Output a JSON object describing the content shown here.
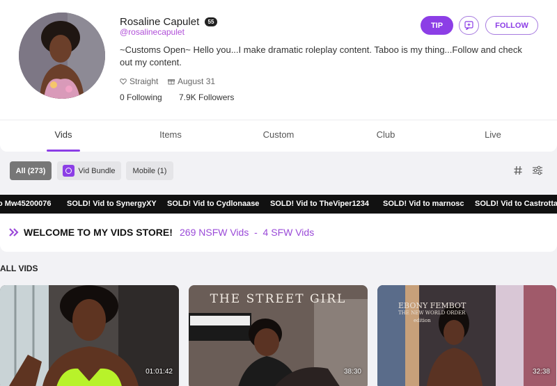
{
  "profile": {
    "name": "Rosaline Capulet",
    "level": "55",
    "handle": "@rosalinecapulet",
    "bio": "~Customs Open~ Hello you...I make dramatic roleplay content. Taboo is my thing...Follow and check out my content.",
    "orientation": "Straight",
    "birthday": "August 31",
    "following": "0 Following",
    "followers": "7.9K Followers"
  },
  "actions": {
    "tip_label": "TIP",
    "follow_label": "FOLLOW"
  },
  "tabs": [
    {
      "label": "Vids"
    },
    {
      "label": "Items"
    },
    {
      "label": "Custom"
    },
    {
      "label": "Club"
    },
    {
      "label": "Live"
    }
  ],
  "filters": {
    "all": "All (273)",
    "vid_bundle": "Vid Bundle",
    "mobile": "Mobile (1)"
  },
  "ticker": [
    "o Mw45200076",
    "SOLD! Vid to SynergyXY",
    "SOLD! Vid to Cydlonaase",
    "SOLD! Vid to TheViper1234",
    "SOLD! Vid to marnosc",
    "SOLD! Vid to Castrotta"
  ],
  "welcome": {
    "title": "WELCOME TO MY VIDS STORE!",
    "counts": "269 NSFW Vids  -  4 SFW Vids"
  },
  "section_title": "ALL VIDS",
  "videos": [
    {
      "duration": "01:01:42"
    },
    {
      "title": "THE STREET GIRL",
      "duration": "38:30"
    },
    {
      "caption_line1": "EBONY FEMBOT",
      "caption_line2": "THE NEW WORLD ORDER",
      "caption_line3": "edition",
      "duration": "32:38"
    }
  ],
  "colors": {
    "accent": "#8c3ee6",
    "handle": "#b04ed8",
    "ticker_bg": "#111111"
  }
}
